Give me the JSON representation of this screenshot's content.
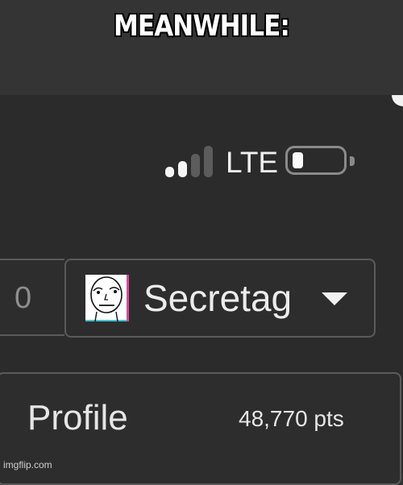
{
  "caption": "MEANWHILE:",
  "status_bar": {
    "network": "LTE",
    "signal_bars_filled": 2,
    "signal_bars_total": 4,
    "battery_level": 0.2
  },
  "user_bar": {
    "count": "0",
    "username": "Secretag",
    "avatar_icon": "poker-face-meme-icon",
    "dropdown_icon": "caret-down-icon"
  },
  "profile": {
    "label": "Profile",
    "points": "48,770 pts"
  },
  "watermark": "imgflip.com",
  "colors": {
    "background": "#2b2b2b",
    "text": "#ececec",
    "muted": "#8e8e8e",
    "border": "#5a5a5a"
  }
}
